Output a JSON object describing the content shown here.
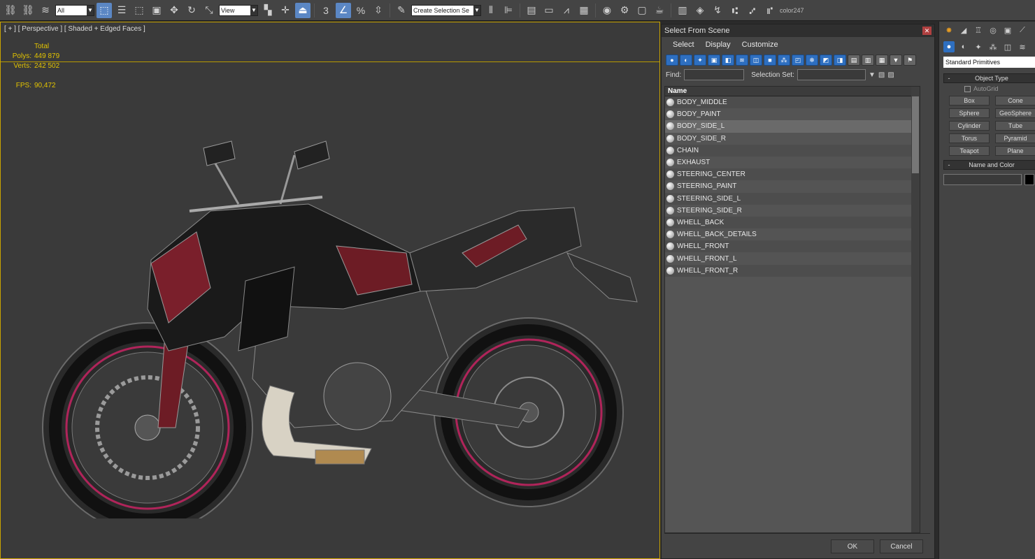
{
  "toolbar": {
    "filter_value": "All",
    "view_value": "View",
    "selection_set_value": "Create Selection Se",
    "color_label": "color247",
    "snaps": [
      "3",
      "n",
      "%",
      "n"
    ]
  },
  "viewport": {
    "label": "[ + ] [ Perspective ] [ Shaded + Edged Faces ]",
    "stats": {
      "total_label": "Total",
      "polys_label": "Polys:",
      "polys_value": "449 879",
      "verts_label": "Verts:",
      "verts_value": "242 502",
      "fps_label": "FPS:",
      "fps_value": "90,472"
    }
  },
  "dialog": {
    "title": "Select From Scene",
    "menu": [
      "Select",
      "Display",
      "Customize"
    ],
    "find_label": "Find:",
    "selection_set_label": "Selection Set:",
    "column_header": "Name",
    "items": [
      {
        "name": "BODY_MIDDLE",
        "selected": false
      },
      {
        "name": "BODY_PAINT",
        "selected": false
      },
      {
        "name": "BODY_SIDE_L",
        "selected": true
      },
      {
        "name": "BODY_SIDE_R",
        "selected": false
      },
      {
        "name": "CHAIN",
        "selected": false
      },
      {
        "name": "EXHAUST",
        "selected": false
      },
      {
        "name": "STEERING_CENTER",
        "selected": false
      },
      {
        "name": "STEERING_PAINT",
        "selected": false
      },
      {
        "name": "STEERING_SIDE_L",
        "selected": false
      },
      {
        "name": "STEERING_SIDE_R",
        "selected": false
      },
      {
        "name": "WHELL_BACK",
        "selected": false
      },
      {
        "name": "WHELL_BACK_DETAILS",
        "selected": false
      },
      {
        "name": "WHELL_FRONT",
        "selected": false
      },
      {
        "name": "WHELL_FRONT_L",
        "selected": false
      },
      {
        "name": "WHELL_FRONT_R",
        "selected": false
      }
    ],
    "ok_label": "OK",
    "cancel_label": "Cancel"
  },
  "command_panel": {
    "dropdown_value": "Standard Primitives",
    "object_type_title": "Object Type",
    "autogrid_label": "AutoGrid",
    "buttons": [
      "Box",
      "Cone",
      "Sphere",
      "GeoSphere",
      "Cylinder",
      "Tube",
      "Torus",
      "Pyramid",
      "Teapot",
      "Plane"
    ],
    "name_color_title": "Name and Color"
  },
  "colors": {
    "viewport_border": "#c9a400",
    "stats_text": "#e3c400",
    "active_blue": "#2e6fc0",
    "bike_red": "#8a1f2c"
  }
}
